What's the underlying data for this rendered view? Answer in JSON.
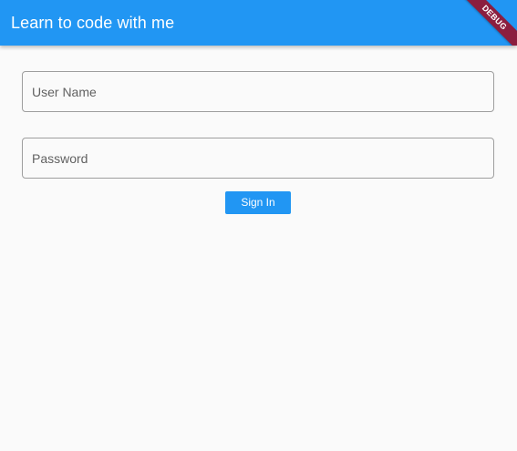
{
  "app_bar": {
    "title": "Learn to code with me",
    "debug_banner": "DEBUG"
  },
  "form": {
    "username": {
      "placeholder": "User Name",
      "value": ""
    },
    "password": {
      "placeholder": "Password",
      "value": ""
    },
    "sign_in_label": "Sign In"
  },
  "colors": {
    "primary": "#2196f3",
    "background": "#fafafa",
    "debug_banner": "#8b1e3f"
  }
}
